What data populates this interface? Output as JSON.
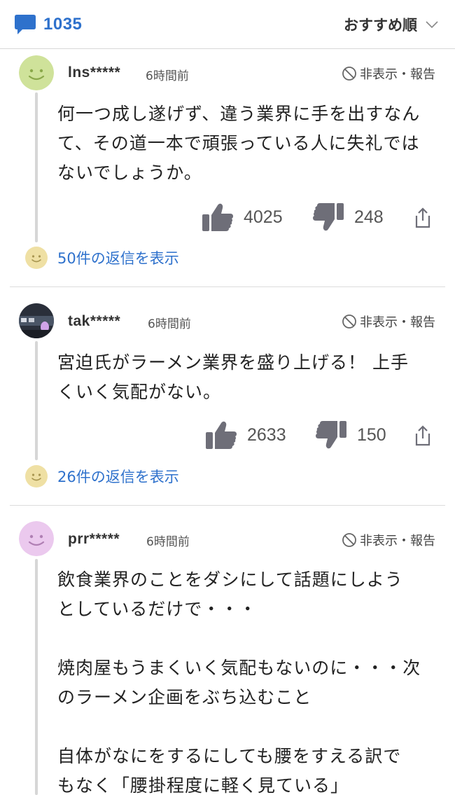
{
  "header": {
    "comment_count": "1035",
    "sort_label": "おすすめ順",
    "accent_color": "#2e71cc"
  },
  "comments": [
    {
      "user": "lns*****",
      "time": "6時間前",
      "hide_report": "非表示・報告",
      "avatar": "smiley-green",
      "lines": [
        "何一つ成し遂げず、違う業界に手を出すなん",
        "て、その道一本で頑張っている人に失礼では",
        "ないでしょうか。"
      ],
      "likes": "4025",
      "dislikes": "248",
      "replies_label": "50件の返信を表示"
    },
    {
      "user": "tak*****",
      "time": "6時間前",
      "hide_report": "非表示・報告",
      "avatar": "photo-night-street",
      "lines": [
        "宮迫氏がラーメン業界を盛り上げる！ 上手",
        "くいく気配がない。"
      ],
      "likes": "2633",
      "dislikes": "150",
      "replies_label": "26件の返信を表示"
    },
    {
      "user": "prr*****",
      "time": "6時間前",
      "hide_report": "非表示・報告",
      "avatar": "smiley-purple",
      "lines": [
        "飲食業界のことをダシにして話題にしよう",
        "としているだけで・・・",
        "",
        "焼肉屋もうまくいく気配もないのに・・・次",
        "のラーメン企画をぶち込むこと",
        "",
        "自体がなにをするにしても腰をすえる訳で",
        "もなく「腰掛程度に軽く見ている」"
      ]
    }
  ]
}
